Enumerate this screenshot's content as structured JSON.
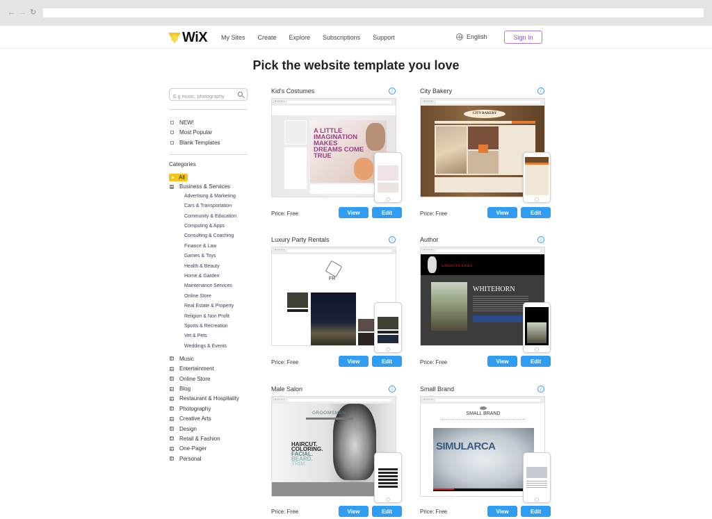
{
  "browser": {
    "back_icon": "arrow-left-icon",
    "forward_icon": "arrow-right-icon",
    "reload_icon": "reload-icon",
    "url": ""
  },
  "header": {
    "logo_text": "WiX",
    "nav": [
      "My Sites",
      "Create",
      "Explore",
      "Subscriptions",
      "Support"
    ],
    "language": "English",
    "sign_in": "Sign In",
    "accent_color": "#9b4fc8"
  },
  "page_title": "Pick the website template you love",
  "sidebar": {
    "search_placeholder": "E.g music, photography",
    "quick_filters": [
      "NEW!",
      "Most Popular",
      "Blank Templates"
    ],
    "categories_heading": "Categories",
    "selected_category": "All",
    "expanded_category": "Business & Services",
    "subcategories": [
      "Advertising & Marketing",
      "Cars & Transportation",
      "Community & Education",
      "Computing & Apps",
      "Consulting & Coaching",
      "Finance & Law",
      "Games & Toys",
      "Health & Beauty",
      "Home & Garden",
      "Maintenance Services",
      "Online Store",
      "Real Estate & Property",
      "Religion & Non Profit",
      "Sports & Recreation",
      "Vet & Pets",
      "Weddings & Events"
    ],
    "other_categories": [
      "Music",
      "Entertainment",
      "Online Store",
      "Blog",
      "Restaurant & Hospitality",
      "Photography",
      "Creative Arts",
      "Design",
      "Retail & Fashion",
      "One-Pager",
      "Personal"
    ]
  },
  "templates": [
    {
      "name": "Kid's Costumes",
      "price": "Price: Free",
      "view": "View",
      "edit": "Edit",
      "hero_text": "A LITTLE IMAGINATION MAKES DREAMS COME TRUE"
    },
    {
      "name": "City Bakery",
      "price": "Price: Free",
      "view": "View",
      "edit": "Edit",
      "hero_text": "CITY BAKERY"
    },
    {
      "name": "Luxury Party Rentals",
      "price": "Price: Free",
      "view": "View",
      "edit": "Edit",
      "hero_text": "FR"
    },
    {
      "name": "Author",
      "price": "Price: Free",
      "view": "View",
      "edit": "Edit",
      "hero_text": "WHITEHORN",
      "sub_text": "SAMANTA JONES"
    },
    {
      "name": "Male Salon",
      "price": "Price: Free",
      "view": "View",
      "edit": "Edit",
      "hero_text": "GROOMSMEN",
      "sub_lines": [
        "HAIRCUT.",
        "COLORING.",
        "FACIAL.",
        "BEARD.",
        "TRIM."
      ]
    },
    {
      "name": "Small Brand",
      "price": "Price: Free",
      "view": "View",
      "edit": "Edit",
      "hero_text": "SMALL BRAND",
      "sub_text": "SIMULARCA"
    }
  ],
  "colors": {
    "button_blue": "#2f9df1",
    "selected_category": "#f5c518",
    "info_icon": "#3b97e3"
  }
}
